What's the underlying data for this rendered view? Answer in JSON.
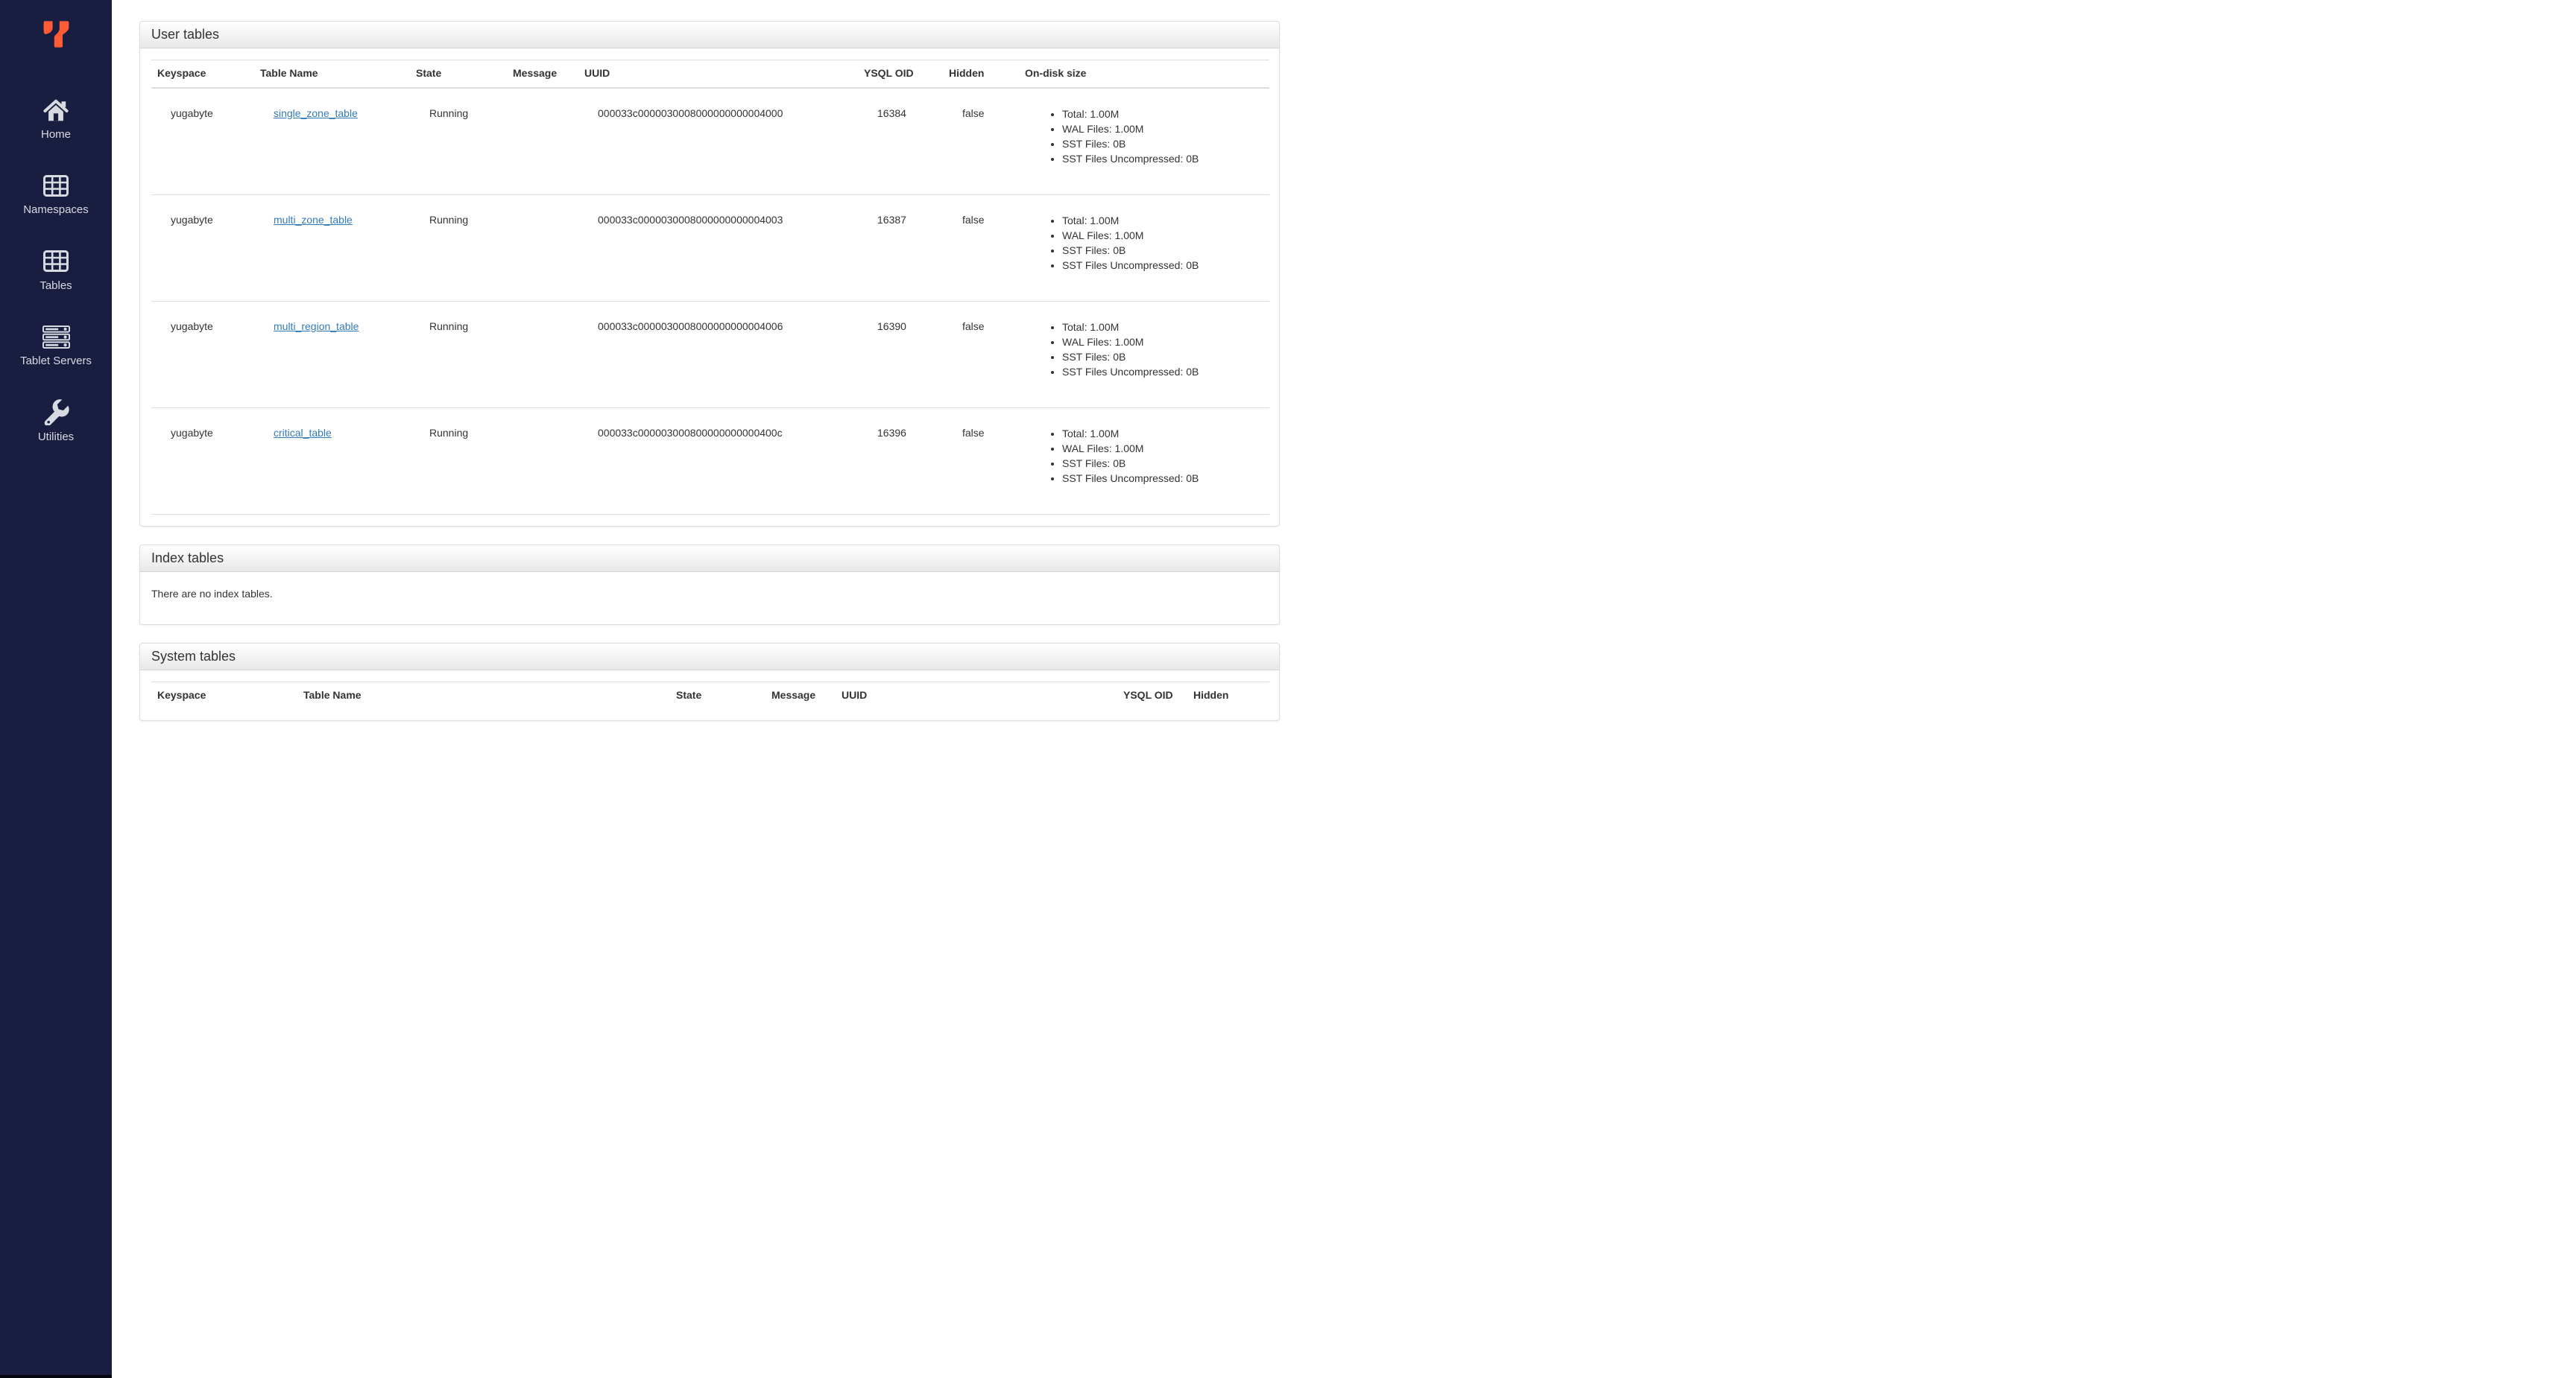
{
  "colors": {
    "sidebar_bg": "#191d3f",
    "brand_orange": "#ff5c35",
    "link_blue": "#337ab7"
  },
  "sidebar": {
    "items": [
      {
        "label": "Home"
      },
      {
        "label": "Namespaces"
      },
      {
        "label": "Tables"
      },
      {
        "label": "Tablet Servers"
      },
      {
        "label": "Utilities"
      }
    ]
  },
  "user_tables": {
    "title": "User tables",
    "columns": [
      "Keyspace",
      "Table Name",
      "State",
      "Message",
      "UUID",
      "YSQL OID",
      "Hidden",
      "On-disk size"
    ],
    "rows": [
      {
        "keyspace": "yugabyte",
        "table_name": "single_zone_table",
        "state": "Running",
        "message": "",
        "uuid": "000033c0000030008000000000004000",
        "ysql_oid": "16384",
        "hidden": "false",
        "on_disk": [
          "Total: 1.00M",
          "WAL Files: 1.00M",
          "SST Files: 0B",
          "SST Files Uncompressed: 0B"
        ]
      },
      {
        "keyspace": "yugabyte",
        "table_name": "multi_zone_table",
        "state": "Running",
        "message": "",
        "uuid": "000033c0000030008000000000004003",
        "ysql_oid": "16387",
        "hidden": "false",
        "on_disk": [
          "Total: 1.00M",
          "WAL Files: 1.00M",
          "SST Files: 0B",
          "SST Files Uncompressed: 0B"
        ]
      },
      {
        "keyspace": "yugabyte",
        "table_name": "multi_region_table",
        "state": "Running",
        "message": "",
        "uuid": "000033c0000030008000000000004006",
        "ysql_oid": "16390",
        "hidden": "false",
        "on_disk": [
          "Total: 1.00M",
          "WAL Files: 1.00M",
          "SST Files: 0B",
          "SST Files Uncompressed: 0B"
        ]
      },
      {
        "keyspace": "yugabyte",
        "table_name": "critical_table",
        "state": "Running",
        "message": "",
        "uuid": "000033c000003000800000000000400c",
        "ysql_oid": "16396",
        "hidden": "false",
        "on_disk": [
          "Total: 1.00M",
          "WAL Files: 1.00M",
          "SST Files: 0B",
          "SST Files Uncompressed: 0B"
        ]
      }
    ]
  },
  "index_tables": {
    "title": "Index tables",
    "empty_message": "There are no index tables."
  },
  "system_tables": {
    "title": "System tables",
    "columns": [
      "Keyspace",
      "Table Name",
      "State",
      "Message",
      "UUID",
      "YSQL OID",
      "Hidden"
    ]
  }
}
